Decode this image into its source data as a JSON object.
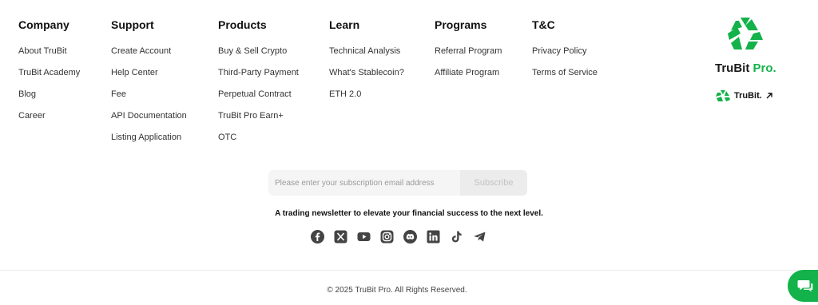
{
  "columns": [
    {
      "title": "Company",
      "links": [
        "About TruBit",
        "TruBit Academy",
        "Blog",
        "Career"
      ]
    },
    {
      "title": "Support",
      "links": [
        "Create Account",
        "Help Center",
        "Fee",
        "API Documentation",
        "Listing Application"
      ]
    },
    {
      "title": "Products",
      "links": [
        "Buy & Sell Crypto",
        "Third-Party Payment",
        "Perpetual Contract",
        "TruBit Pro Earn+",
        "OTC"
      ]
    },
    {
      "title": "Learn",
      "links": [
        "Technical Analysis",
        "What's Stablecoin?",
        "ETH 2.0"
      ]
    },
    {
      "title": "Programs",
      "links": [
        "Referral Program",
        "Affiliate Program"
      ]
    },
    {
      "title": "T&C",
      "links": [
        "Privacy Policy",
        "Terms of Service"
      ]
    }
  ],
  "brand": {
    "name_main": "TruBit",
    "name_accent": "Pro.",
    "sub_link": "TruBit.",
    "accent_color": "#13b24a"
  },
  "subscribe": {
    "placeholder": "Please enter your subscription email address",
    "button": "Subscribe"
  },
  "tagline": "A trading newsletter to elevate your financial success to the next level.",
  "socials": [
    "facebook-icon",
    "x-icon",
    "youtube-icon",
    "instagram-icon",
    "discord-icon",
    "linkedin-icon",
    "tiktok-icon",
    "telegram-icon"
  ],
  "copyright": "© 2025 TruBit Pro. All Rights Reserved.",
  "chat": {
    "icon": "chat-icon",
    "color": "#13b24a"
  }
}
